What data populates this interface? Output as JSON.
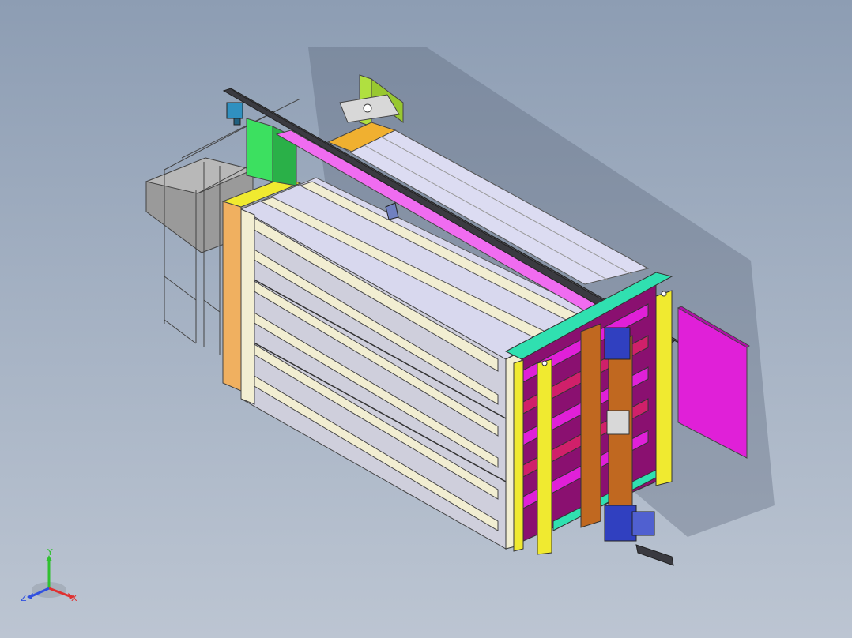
{
  "viewport": {
    "background_top": "#8d9db3",
    "background_bottom": "#bcc5d2"
  },
  "model": {
    "colors": {
      "frame_gray": "#c9cad6",
      "panel_lavender": "#dcdcf2",
      "rail_cream": "#f2eed2",
      "rail_dark": "#3a3a40",
      "magenta": "#e020d8",
      "pink_strip": "#f06cf0",
      "crimson": "#d0206a",
      "orange_plate": "#f0b060",
      "yellow_column": "#f0ea30",
      "green_plate": "#3ce060",
      "lime_bracket": "#b0e040",
      "teal": "#30e0b0",
      "blue_block": "#3040c0",
      "brown_post": "#c06820",
      "cyan_motor": "#3090c0"
    }
  },
  "triad": {
    "x_label": "X",
    "y_label": "Y",
    "z_label": "Z",
    "x_color": "#e03030",
    "y_color": "#30c030",
    "z_color": "#3050e0",
    "label_color": "#e03030"
  }
}
